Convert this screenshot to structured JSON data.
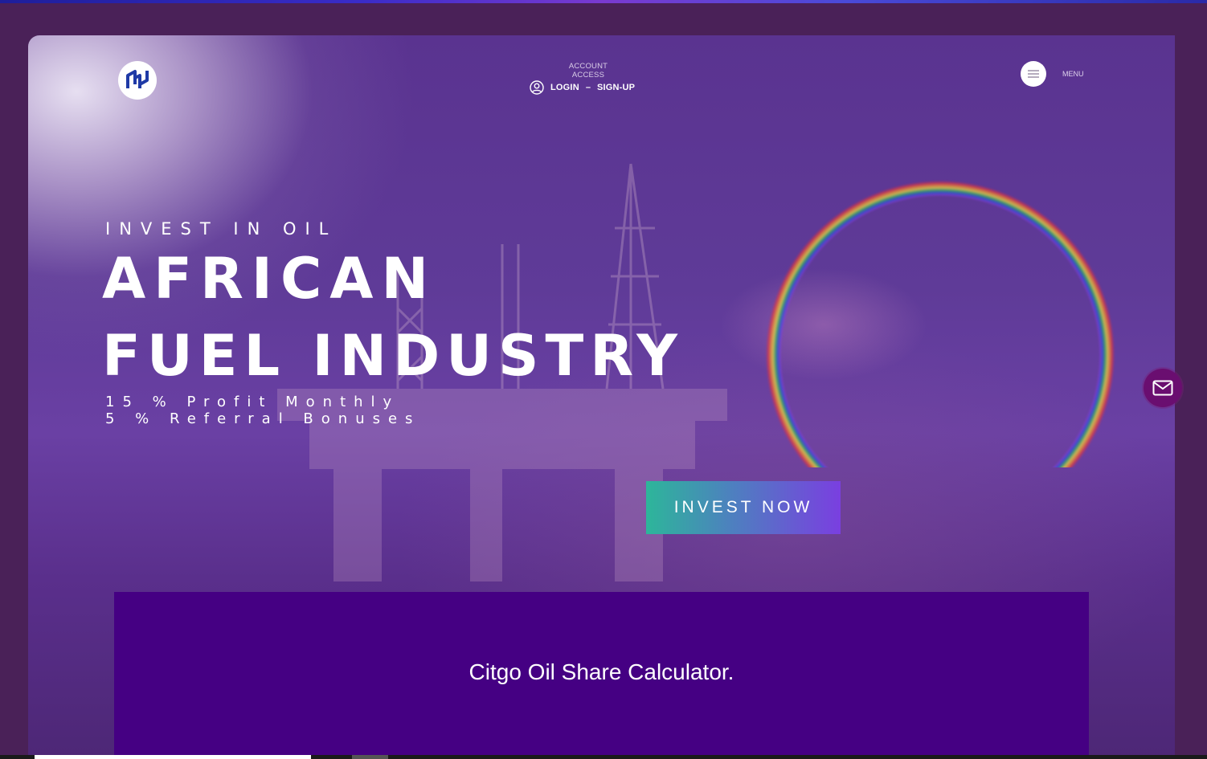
{
  "header": {
    "account_label": "ACCOUNT ACCESS",
    "login_label": "LOGIN",
    "separator": "–",
    "signup_label": "SIGN-UP",
    "menu_label": "MENU"
  },
  "hero": {
    "eyebrow": "INVEST IN OIL",
    "headline_line1": "AFRICAN",
    "headline_line2": "FUEL INDUSTRY",
    "sub_line1": "15 % Profit Monthly",
    "sub_line2": "5 % Referral Bonuses",
    "cta_label": "INVEST NOW"
  },
  "calculator": {
    "title": "Citgo Oil Share Calculator."
  },
  "icons": {
    "logo": "brand-logo-icon",
    "user": "user-circle-icon",
    "menu": "hamburger-menu-icon",
    "mail": "mail-icon"
  },
  "colors": {
    "page_bg": "#4a2158",
    "panel_bg": "#450083",
    "cta_gradient_start": "#2db69a",
    "cta_gradient_end": "#7a3fe0",
    "mail_button": "#6a0e70"
  }
}
